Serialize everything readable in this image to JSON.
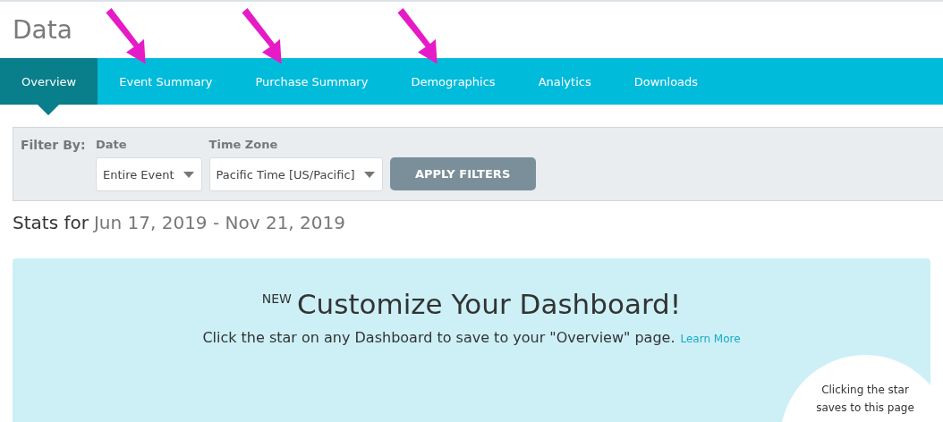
{
  "page": {
    "title": "Data"
  },
  "tabs": [
    {
      "label": "Overview",
      "selected": true,
      "annotated": false
    },
    {
      "label": "Event Summary",
      "selected": false,
      "annotated": true
    },
    {
      "label": "Purchase Summary",
      "selected": false,
      "annotated": true
    },
    {
      "label": "Demographics",
      "selected": false,
      "annotated": true
    },
    {
      "label": "Analytics",
      "selected": false,
      "annotated": false
    },
    {
      "label": "Downloads",
      "selected": false,
      "annotated": false
    }
  ],
  "filters": {
    "label": "Filter By:",
    "fields": [
      {
        "label": "Date",
        "value": "Entire Event"
      },
      {
        "label": "Time Zone",
        "value": "Pacific Time [US/Pacific]"
      }
    ],
    "button": "APPLY FILTERS"
  },
  "stats": {
    "prefix": "Stats for",
    "range": "Jun 17, 2019 - Nov 21, 2019"
  },
  "banner": {
    "badge": "NEW",
    "heading": "Customize Your Dashboard!",
    "text": "Click the star on any Dashboard to save to your \"Overview\" page.",
    "link": "Learn More",
    "callout": [
      "Clicking the star",
      "saves to this page"
    ]
  }
}
